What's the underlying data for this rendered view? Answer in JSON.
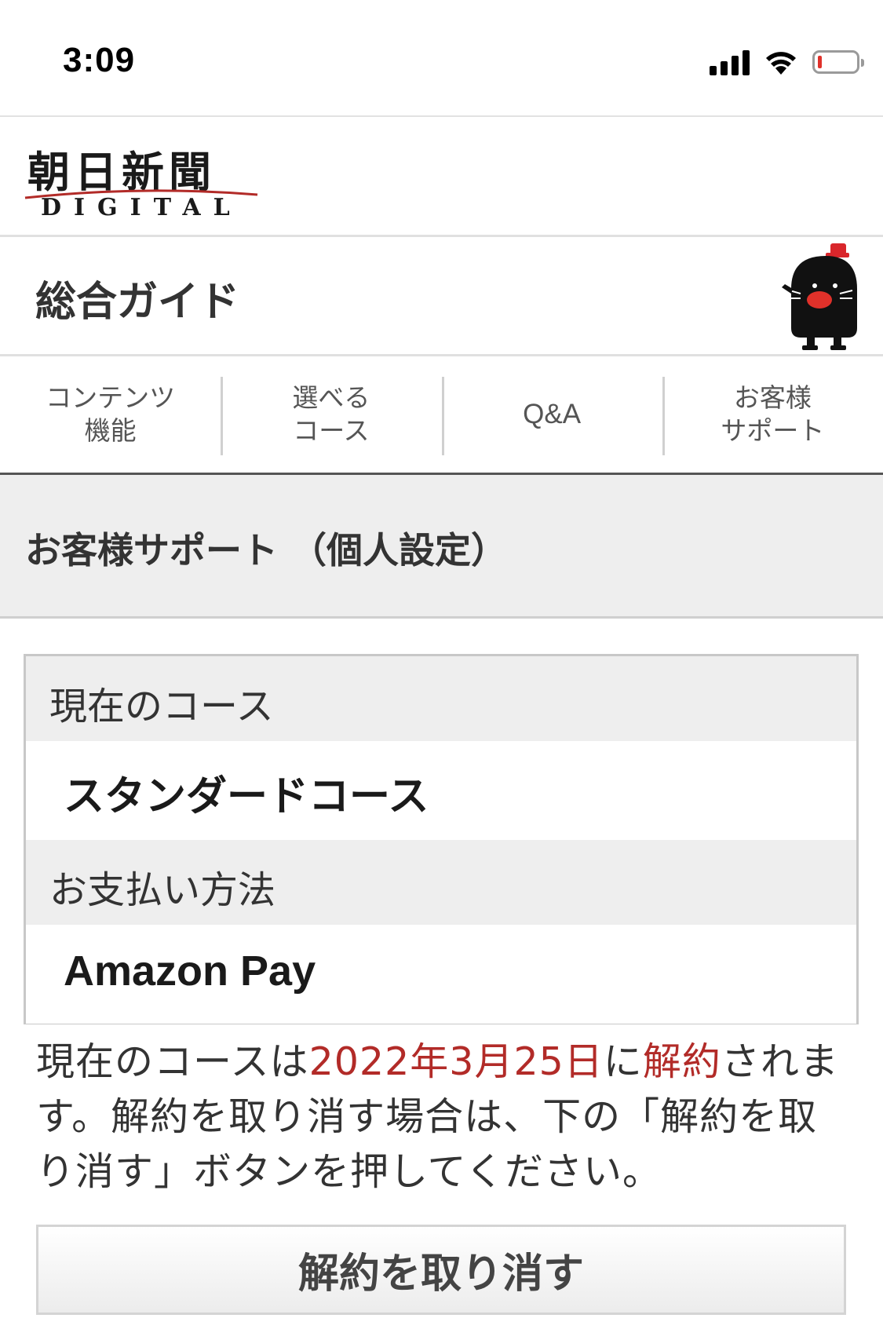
{
  "status_bar": {
    "time": "3:09",
    "signal_icon": "cellular-signal-icon",
    "wifi_icon": "wifi-icon",
    "battery_icon": "battery-low-icon"
  },
  "brand": {
    "logo_text": "朝日新聞",
    "logo_sub": "DIGITAL",
    "accent_color": "#b22b28"
  },
  "guide": {
    "title": "総合ガイド",
    "mascot_icon": "mascot-icon"
  },
  "tabs": [
    {
      "line1": "コンテンツ",
      "line2": "機能"
    },
    {
      "line1": "選べる",
      "line2": "コース"
    },
    {
      "line1": "Q&A",
      "line2": ""
    },
    {
      "line1": "お客様",
      "line2": "サポート"
    }
  ],
  "section": {
    "title": "お客様サポート （個人設定）"
  },
  "info": {
    "course_label": "現在のコース",
    "course_value": "スタンダードコース",
    "payment_label": "お支払い方法",
    "payment_value": "Amazon Pay"
  },
  "notice": {
    "part1": "現在のコースは",
    "date": "2022年3月25日",
    "part2": "に",
    "cancel_word": "解約",
    "part3": "されます。解約を取り消す場合は、下の「解約を取り消す」ボタンを押してください。"
  },
  "actions": {
    "undo_cancel_label": "解約を取り消す"
  }
}
